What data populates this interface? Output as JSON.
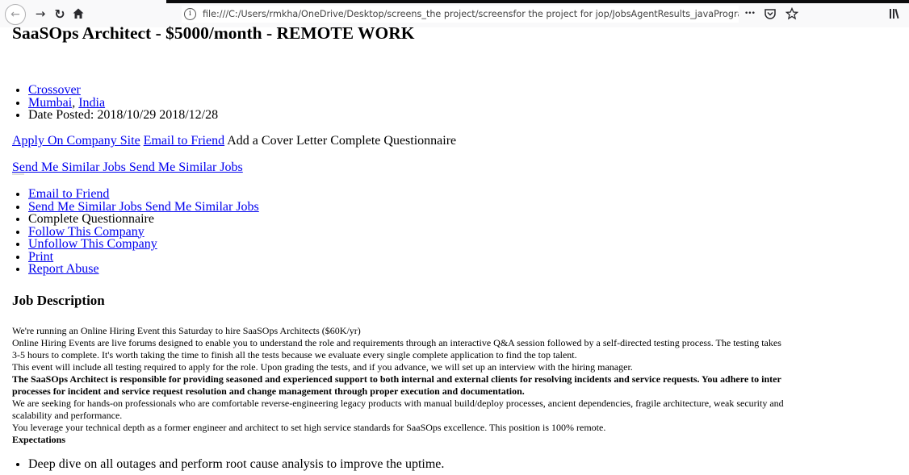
{
  "browser": {
    "url": "file:///C:/Users/rmkha/OneDrive/Desktop/screens_the project/screensfor the project for jop/JobsAgentResults_javaProgram",
    "info_glyph": "i",
    "more_glyph": "•••"
  },
  "page": {
    "title": "SaaSOps Architect - $5000/month - REMOTE WORK",
    "company": "Crossover",
    "city": "Mumbai",
    "separator": ", ",
    "country": "India",
    "date_posted": "Date Posted: 2018/10/29 2018/12/28",
    "apply_link": "Apply On Company Site",
    "email_friend_link": "Email to Friend",
    "cover_and_questionnaire": "Add a Cover Letter Complete Questionnaire",
    "similar_jobs_link": "Send Me Similar Jobs Send Me Similar Jobs",
    "actions": {
      "email_friend": "Email to Friend",
      "similar_jobs": "Send Me Similar Jobs Send Me Similar Jobs",
      "questionnaire": "Complete Questionnaire",
      "follow": "Follow This Company",
      "unfollow": "Unfollow This Company",
      "print": "Print",
      "report": "Report Abuse"
    },
    "job_description_heading": "Job Description",
    "description": {
      "line1": "We're running an Online Hiring Event this Saturday to hire SaaSOps Architects ($60K/yr)",
      "line2": "Online Hiring Events are live forums designed to enable you to understand the role and requirements through an interactive Q&A session followed by a self-directed testing process. The testing takes",
      "line3": "3-5 hours to complete. It's worth taking the time to finish all the tests because we evaluate every single complete application to find the top talent.",
      "line4": "This event will include all testing required to apply for the role. Upon grading the tests, and if you advance, we will set up an interview with the hiring manager.",
      "bold1": "The SaaSOps Architect is responsible for providing seasoned and experienced support to both internal and external clients for resolving incidents and service requests. You adhere to inter",
      "bold2": "processes for incident and service request resolution and change management through proper execution and documentation.",
      "line5": "We are seeking for hands-on professionals who are comfortable reverse-engineering legacy products with manual build/deploy processes, ancient dependencies, fragile architecture, weak security and",
      "line6": "scalability and performance.",
      "line7": "You leverage your technical depth as a former engineer and architect to set high service standards for SaaSOps excellence. This position is 100% remote.",
      "expectations_heading": "Expectations"
    },
    "expectations": [
      "Deep dive on all outages and perform root cause analysis to improve the uptime."
    ]
  }
}
